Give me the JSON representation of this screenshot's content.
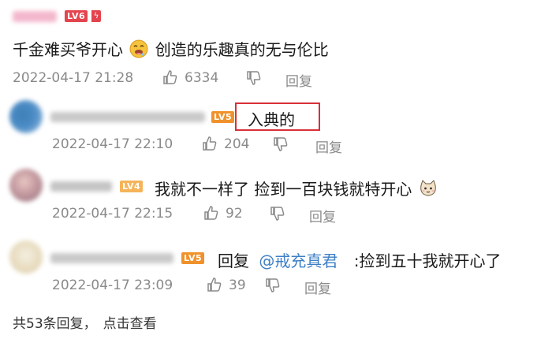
{
  "main_comment": {
    "level_badge": "LV6",
    "text": "千金难买爷开心",
    "text_after_emoji": "创造的乐趣真的无与伦比",
    "emoji": "drooling-face-emoji",
    "timestamp": "2022-04-17 21:28",
    "likes": "6334",
    "reply_label": "回复"
  },
  "replies": [
    {
      "level_badge": "LV5",
      "text": "入典的",
      "timestamp": "2022-04-17 22:10",
      "likes": "204",
      "reply_label": "回复",
      "highlight_color": "#d9303a"
    },
    {
      "level_badge": "LV4",
      "text": "我就不一样了 捡到一百块钱就特开心",
      "emoji": "cat-face-emoji",
      "timestamp": "2022-04-17 22:15",
      "likes": "92",
      "reply_label": "回复"
    },
    {
      "level_badge": "LV5",
      "reply_prefix": "回复",
      "mention": "@戒充真君",
      "text": ":捡到五十我就开心了",
      "timestamp": "2022-04-17 23:09",
      "likes": "39",
      "reply_label": "回复",
      "mention_color": "#3e7fc6"
    }
  ],
  "footer": {
    "summary": "共53条回复，",
    "action": "点击查看"
  },
  "colors": {
    "lv6": "#e4444d",
    "lv5": "#f0922c",
    "lv4": "#f5b45a"
  }
}
